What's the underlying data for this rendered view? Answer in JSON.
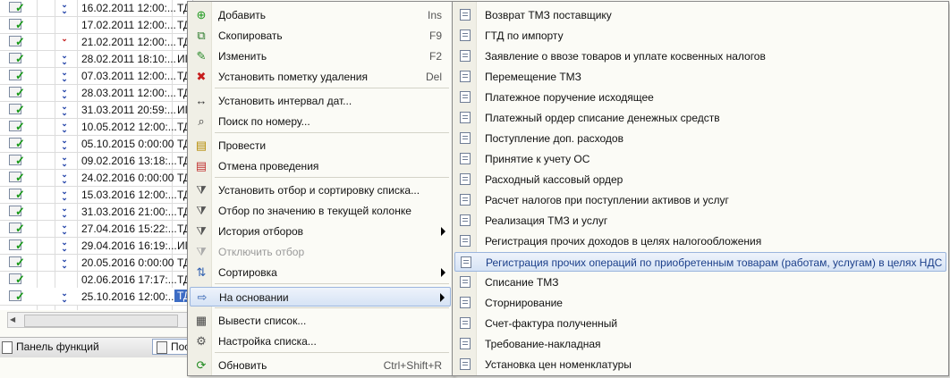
{
  "grid": {
    "rows": [
      {
        "date": "16.02.2011 12:00:...",
        "tag": "ТД",
        "arrow": "blue"
      },
      {
        "date": "17.02.2011 12:00:...",
        "tag": "ТД",
        "arrow": ""
      },
      {
        "date": "21.02.2011 12:00:...",
        "tag": "ТД",
        "arrow": "red"
      },
      {
        "date": "28.02.2011 18:10:...",
        "tag": "ИГ",
        "arrow": "blue"
      },
      {
        "date": "07.03.2011 12:00:...",
        "tag": "ТД",
        "arrow": "blue"
      },
      {
        "date": "28.03.2011 12:00:...",
        "tag": "ТД",
        "arrow": "blue"
      },
      {
        "date": "31.03.2011 20:59:...",
        "tag": "ИГ",
        "arrow": "blue"
      },
      {
        "date": "10.05.2012 12:00:...",
        "tag": "ТД",
        "arrow": "blue"
      },
      {
        "date": "05.10.2015 0:00:00",
        "tag": "ТД",
        "arrow": "blue"
      },
      {
        "date": "09.02.2016 13:18:...",
        "tag": "ТД",
        "arrow": "blue"
      },
      {
        "date": "24.02.2016 0:00:00",
        "tag": "ТД",
        "arrow": "blue"
      },
      {
        "date": "15.03.2016 12:00:...",
        "tag": "ТД",
        "arrow": "blue"
      },
      {
        "date": "31.03.2016 21:00:...",
        "tag": "ТД",
        "arrow": "blue"
      },
      {
        "date": "27.04.2016 15:22:...",
        "tag": "ТД",
        "arrow": "blue"
      },
      {
        "date": "29.04.2016 16:19:...",
        "tag": "ИГ",
        "arrow": "blue"
      },
      {
        "date": "20.05.2016 0:00:00",
        "tag": "ТД",
        "arrow": "blue"
      },
      {
        "date": "02.06.2016 17:17:...",
        "tag": "ТД",
        "arrow": ""
      },
      {
        "date": "25.10.2016 12:00:...",
        "tag": "ТД",
        "arrow": "blue",
        "selected": true
      }
    ]
  },
  "taskbar": {
    "functions_panel": "Панель функций",
    "second_tab": "Пос"
  },
  "context_menu": {
    "items": [
      {
        "label": "Добавить",
        "shortcut": "Ins",
        "icon": "add-icon"
      },
      {
        "label": "Скопировать",
        "shortcut": "F9",
        "icon": "copy-icon"
      },
      {
        "label": "Изменить",
        "shortcut": "F2",
        "icon": "edit-icon"
      },
      {
        "label": "Установить пометку удаления",
        "shortcut": "Del",
        "icon": "delete-mark-icon"
      },
      {
        "label": "Установить интервал дат...",
        "shortcut": "",
        "icon": "date-interval-icon"
      },
      {
        "label": "Поиск по номеру...",
        "shortcut": "",
        "icon": "search-icon"
      },
      {
        "label": "Провести",
        "shortcut": "",
        "icon": "post-icon"
      },
      {
        "label": "Отмена проведения",
        "shortcut": "",
        "icon": "unpost-icon"
      },
      {
        "label": "Установить отбор и сортировку списка...",
        "shortcut": "",
        "icon": "filter-sort-icon"
      },
      {
        "label": "Отбор по значению в текущей колонке",
        "shortcut": "",
        "icon": "filter-value-icon"
      },
      {
        "label": "История отборов",
        "shortcut": "",
        "icon": "filter-history-icon",
        "submenu": true
      },
      {
        "label": "Отключить отбор",
        "shortcut": "",
        "icon": "filter-off-icon",
        "disabled": true
      },
      {
        "label": "Сортировка",
        "shortcut": "",
        "icon": "sort-icon",
        "submenu": true
      },
      {
        "label": "На основании",
        "shortcut": "",
        "icon": "based-on-icon",
        "submenu": true,
        "highlighted": true
      },
      {
        "label": "Вывести список...",
        "shortcut": "",
        "icon": "print-list-icon"
      },
      {
        "label": "Настройка списка...",
        "shortcut": "",
        "icon": "list-settings-icon"
      },
      {
        "label": "Обновить",
        "shortcut": "Ctrl+Shift+R",
        "icon": "refresh-icon"
      }
    ]
  },
  "submenu": {
    "items": [
      "Возврат ТМЗ поставщику",
      "ГТД по импорту",
      "Заявление о ввозе товаров и уплате косвенных налогов",
      "Перемещение ТМЗ",
      "Платежное поручение исходящее",
      "Платежный ордер списание денежных средств",
      "Поступление доп. расходов",
      "Принятие к учету ОС",
      "Расходный кассовый ордер",
      "Расчет налогов при поступлении активов и услуг",
      "Реализация ТМЗ и услуг",
      "Регистрация прочих доходов в целях налогообложения",
      "Регистрация прочих операций по приобретенным товарам (работам, услугам) в целях НДС",
      "Списание ТМЗ",
      "Сторнирование",
      "Счет-фактура полученный",
      "Требование-накладная",
      "Установка цен номенклатуры"
    ],
    "highlighted_index": 12
  }
}
